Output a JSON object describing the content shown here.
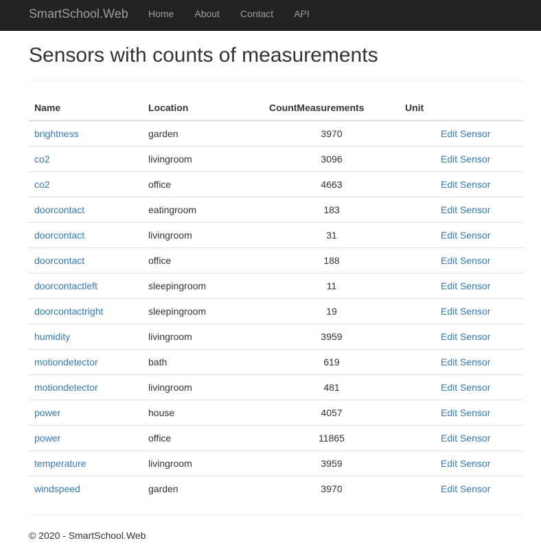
{
  "navbar": {
    "brand": "SmartSchool.Web",
    "links": [
      "Home",
      "About",
      "Contact",
      "API"
    ]
  },
  "page": {
    "title": "Sensors with counts of measurements"
  },
  "table": {
    "headers": [
      "Name",
      "Location",
      "CountMeasurements",
      "Unit",
      ""
    ],
    "rows": [
      {
        "name": "brightness",
        "location": "garden",
        "count": "3970",
        "unit": "",
        "action": "Edit Sensor"
      },
      {
        "name": "co2",
        "location": "livingroom",
        "count": "3096",
        "unit": "",
        "action": "Edit Sensor"
      },
      {
        "name": "co2",
        "location": "office",
        "count": "4663",
        "unit": "",
        "action": "Edit Sensor"
      },
      {
        "name": "doorcontact",
        "location": "eatingroom",
        "count": "183",
        "unit": "",
        "action": "Edit Sensor"
      },
      {
        "name": "doorcontact",
        "location": "livingroom",
        "count": "31",
        "unit": "",
        "action": "Edit Sensor"
      },
      {
        "name": "doorcontact",
        "location": "office",
        "count": "188",
        "unit": "",
        "action": "Edit Sensor"
      },
      {
        "name": "doorcontactleft",
        "location": "sleepingroom",
        "count": "11",
        "unit": "",
        "action": "Edit Sensor"
      },
      {
        "name": "doorcontactright",
        "location": "sleepingroom",
        "count": "19",
        "unit": "",
        "action": "Edit Sensor"
      },
      {
        "name": "humidity",
        "location": "livingroom",
        "count": "3959",
        "unit": "",
        "action": "Edit Sensor"
      },
      {
        "name": "motiondetector",
        "location": "bath",
        "count": "619",
        "unit": "",
        "action": "Edit Sensor"
      },
      {
        "name": "motiondetector",
        "location": "livingroom",
        "count": "481",
        "unit": "",
        "action": "Edit Sensor"
      },
      {
        "name": "power",
        "location": "house",
        "count": "4057",
        "unit": "",
        "action": "Edit Sensor"
      },
      {
        "name": "power",
        "location": "office",
        "count": "11865",
        "unit": "",
        "action": "Edit Sensor"
      },
      {
        "name": "temperature",
        "location": "livingroom",
        "count": "3959",
        "unit": "",
        "action": "Edit Sensor"
      },
      {
        "name": "windspeed",
        "location": "garden",
        "count": "3970",
        "unit": "",
        "action": "Edit Sensor"
      }
    ]
  },
  "footer": {
    "text": "© 2020 - SmartSchool.Web"
  },
  "colors": {
    "navbar_bg": "#222222",
    "nav_text": "#9d9d9d",
    "link": "#337ab7",
    "text": "#333333",
    "border": "#dddddd"
  }
}
